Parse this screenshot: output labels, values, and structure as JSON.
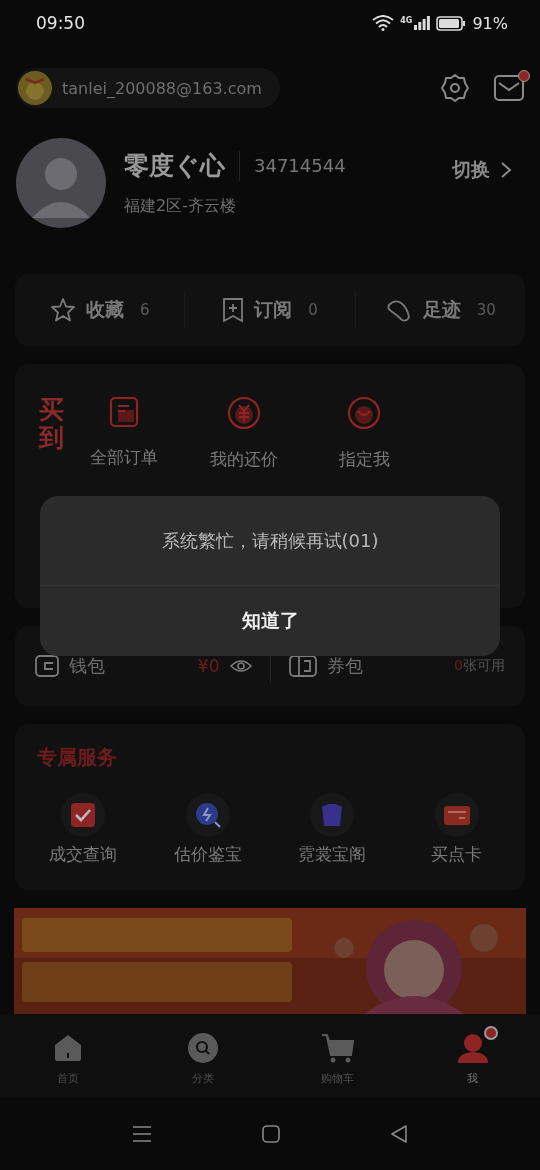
{
  "status_bar": {
    "time": "09:50",
    "network": "4G",
    "battery": "91%"
  },
  "account": {
    "email": "tanlei_200088@163.com",
    "mail_badge": true
  },
  "profile": {
    "name": "零度ぐ心",
    "id": "34714544",
    "server": "福建2区-齐云楼",
    "switch_label": "切换"
  },
  "stats": [
    {
      "kind": "star",
      "label": "收藏",
      "count": "6"
    },
    {
      "kind": "bookmark",
      "label": "订阅",
      "count": "0"
    },
    {
      "kind": "foot",
      "label": "足迹",
      "count": "30"
    }
  ],
  "orders": {
    "title": "买到",
    "items": [
      {
        "kind": "list",
        "label": "全部订单"
      },
      {
        "kind": "yen",
        "label": "我的还价"
      },
      {
        "kind": "smile",
        "label": "指定我"
      }
    ]
  },
  "wallet": {
    "label": "钱包",
    "amount": "¥0"
  },
  "coupons": {
    "label": "券包",
    "count": "0",
    "suffix": "张可用"
  },
  "services": {
    "title": "专属服务",
    "items": [
      {
        "kind": "check",
        "label": "成交查询",
        "color": "#8e2525"
      },
      {
        "kind": "search",
        "label": "估价鉴宝",
        "color": "#2c3a8a"
      },
      {
        "kind": "shirt",
        "label": "霓裳宝阁",
        "color": "#3a2f8a"
      },
      {
        "kind": "card",
        "label": "买点卡",
        "color": "#8a2a20"
      }
    ]
  },
  "dialog": {
    "message": "系统繁忙，请稍候再试(01)",
    "button": "知道了"
  },
  "tabs": [
    {
      "kind": "home",
      "label": "首页",
      "selected": false,
      "badge": false
    },
    {
      "kind": "search",
      "label": "分类",
      "selected": false,
      "badge": false
    },
    {
      "kind": "cart",
      "label": "购物车",
      "selected": false,
      "badge": false
    },
    {
      "kind": "user",
      "label": "我",
      "selected": true,
      "badge": true
    }
  ]
}
